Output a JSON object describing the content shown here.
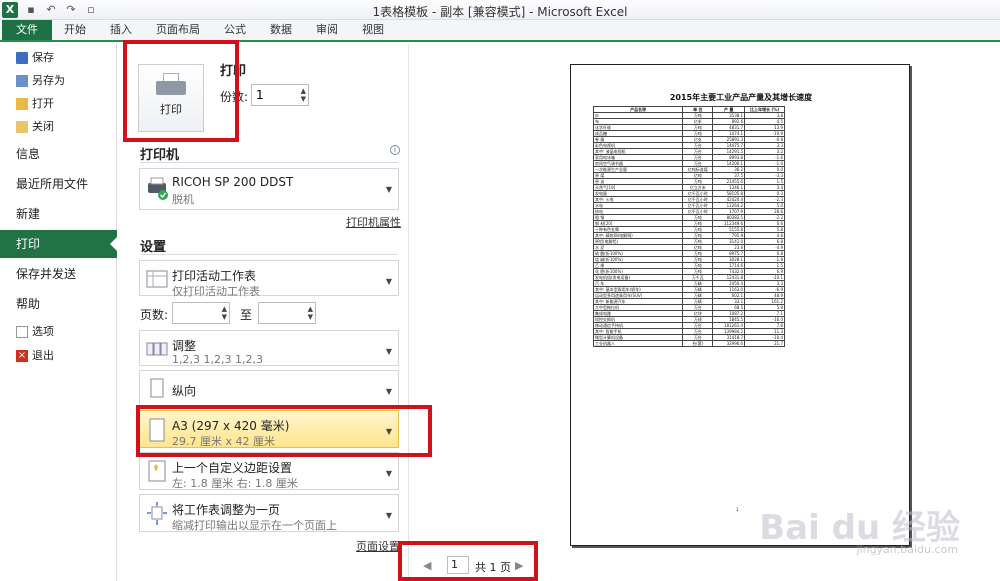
{
  "window": {
    "title": "1表格模板 - 副本  [兼容模式] - Microsoft Excel",
    "app_icon": "X"
  },
  "ribbon_tabs": [
    "文件",
    "开始",
    "插入",
    "页面布局",
    "公式",
    "数据",
    "审阅",
    "视图"
  ],
  "nav": {
    "save": "保存",
    "save_as": "另存为",
    "open": "打开",
    "close": "关闭",
    "info": "信息",
    "recent": "最近所用文件",
    "new": "新建",
    "print": "打印",
    "save_send": "保存并发送",
    "help": "帮助",
    "options": "选项",
    "exit": "退出"
  },
  "print": {
    "button_label": "打印",
    "heading": "打印",
    "copies_label": "份数:",
    "copies_value": "1",
    "printer_section": "打印机",
    "printer_name": "RICOH SP 200 DDST",
    "printer_status": "脱机",
    "printer_props_link": "打印机属性",
    "settings_section": "设置",
    "what_title": "打印活动工作表",
    "what_sub": "仅打印活动工作表",
    "pages_label": "页数:",
    "to_label": "至",
    "collate_title": "调整",
    "collate_sub": "1,2,3    1,2,3    1,2,3",
    "orientation": "纵向",
    "paper_title": "A3 (297 x 420 毫米)",
    "paper_sub": "29.7 厘米 x 42 厘米",
    "margins_title": "上一个自定义边距设置",
    "margins_sub": "左:  1.8 厘米     右:  1.8 厘米",
    "scaling_title": "将工作表调整为一页",
    "scaling_sub": "缩减打印输出以显示在一个页面上",
    "page_setup_link": "页面设置"
  },
  "preview": {
    "doc_title": "2015年主要工业产品产量及其增长速度",
    "headers": [
      "产品名称",
      "单 位",
      "产 量",
      "比上年增长 (%)"
    ],
    "rows": [
      [
        "纱",
        "万吨",
        "3538.1",
        "3.8"
      ],
      [
        "布",
        "亿米",
        "892.6",
        "4.5"
      ],
      [
        "化学纤维",
        "万吨",
        "4831.7",
        "13.9"
      ],
      [
        "成品糖",
        "万吨",
        "1474.1",
        "-10.9"
      ],
      [
        "卷 烟",
        "亿支",
        "25891.3",
        "-0.8"
      ],
      [
        "彩色电视机",
        "万台",
        "14475.7",
        "3.3"
      ],
      [
        "  其中: 液晶电视机",
        "万台",
        "14291.5",
        "3.2"
      ],
      [
        "家用电冰箱",
        "万台",
        "8993.8",
        "-1.6"
      ],
      [
        "房间空气调节器",
        "万台",
        "14200.1",
        "-1.0"
      ],
      [
        "一次能源生产总量",
        "亿吨标准煤",
        "36.2",
        "0.0"
      ],
      [
        "原 煤",
        "亿吨",
        "37.5",
        "-3.3"
      ],
      [
        "原 油",
        "万吨",
        "21455.6",
        "1.5"
      ],
      [
        "天然气[19]",
        "亿立方米",
        "1346.1",
        "3.4"
      ],
      [
        "发电量",
        "亿千瓦小时",
        "58105.8",
        "0.3"
      ],
      [
        "  其中: 火电",
        "亿千瓦小时",
        "42420.4",
        "-2.3"
      ],
      [
        "      水电",
        "亿千瓦小时",
        "11264.2",
        "5.0"
      ],
      [
        "      核电",
        "亿千瓦小时",
        "1707.9",
        "28.6"
      ],
      [
        "粗 钢",
        "万吨",
        "80382.5",
        "-2.2"
      ],
      [
        "钢 材[20]",
        "万吨",
        "112349.6",
        "0.6"
      ],
      [
        "十种有色金属",
        "万吨",
        "5155.8",
        "5.8"
      ],
      [
        "  其中: 精炼铜(电解铜)",
        "万吨",
        "795.9",
        "4.8"
      ],
      [
        "原铝(电解铝)",
        "万吨",
        "3141.0",
        "6.8"
      ],
      [
        "水 泥",
        "亿吨",
        "23.6",
        "-4.9"
      ],
      [
        "硫 酸(折100%)",
        "万吨",
        "8975.7",
        "0.8"
      ],
      [
        "烧 碱(折100%)",
        "万吨",
        "3028.1",
        "-1.8"
      ],
      [
        "乙 烯",
        "万吨",
        "1714.6",
        "1.5"
      ],
      [
        "化 肥(折100%)",
        "万吨",
        "7432.0",
        "6.9"
      ],
      [
        "发电机组(发电设备)",
        "万千瓦",
        "12431.8",
        "-10.1"
      ],
      [
        "汽 车",
        "万辆",
        "2450.4",
        "3.3"
      ],
      [
        "  其中: 基本型乘用车(轿车)",
        "万辆",
        "1163.0",
        "-6.9"
      ],
      [
        "  运动型多用途乘用车(SUV)",
        "万辆",
        "602.1",
        "48.9"
      ],
      [
        "  其中: 新能源汽车",
        "万辆",
        "33.1",
        "161.2"
      ],
      [
        "大中型拖拉机",
        "万台",
        "68.5",
        "5.9"
      ],
      [
        "集成电路",
        "亿块",
        "1087.2",
        "7.1"
      ],
      [
        "程控交换机",
        "万线",
        "1845.5",
        "-16.0"
      ],
      [
        "移动通信手持机",
        "万台",
        "181261.4",
        "7.8"
      ],
      [
        "  其中: 智能手机",
        "万台",
        "139984.2",
        "11.3"
      ],
      [
        "微型计算机设备",
        "万台",
        "31418.7",
        "-10.4"
      ],
      [
        "工业机器人",
        "台(套)",
        "32996.0",
        "21.7"
      ]
    ],
    "page_footer": "1",
    "pager_current": "1",
    "pager_total": "共 1 页"
  },
  "watermark": {
    "main": "Bai du 经验",
    "sub": "jingyan.baidu.com"
  }
}
